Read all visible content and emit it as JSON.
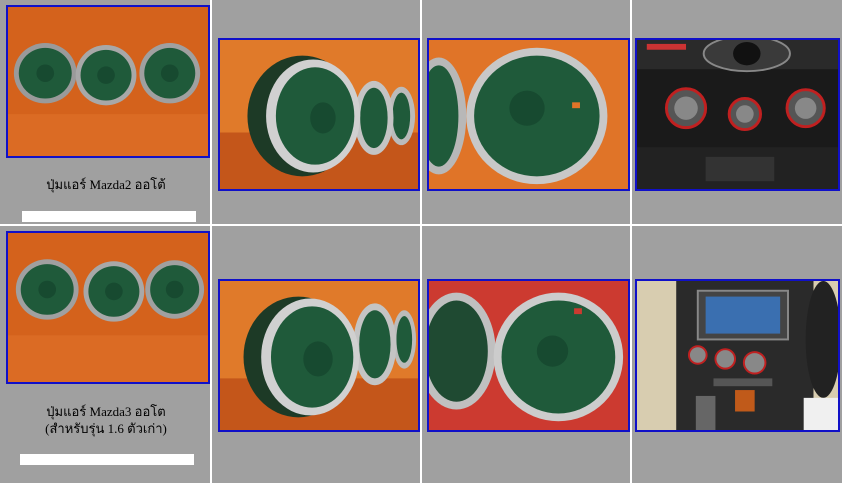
{
  "products": [
    {
      "title_line1": "ปุ่มแอร์ Mazda2 ออโต้",
      "title_line2": "",
      "thumbnails": [
        {
          "name": "three-knobs-photo"
        },
        {
          "name": "knob-side-angle-photo"
        },
        {
          "name": "knob-closeup-photo"
        },
        {
          "name": "dashboard-installed-photo"
        }
      ]
    },
    {
      "title_line1": "ปุ่มแอร์ Mazda3 ออโต",
      "title_line2": "(สำหรับรุ่น 1.6 ตัวเก่า)",
      "thumbnails": [
        {
          "name": "three-knobs-photo"
        },
        {
          "name": "knob-side-angle-photo"
        },
        {
          "name": "knob-closeup-photo"
        },
        {
          "name": "dashboard-installed-photo"
        }
      ]
    }
  ],
  "colors": {
    "page_background": "#a0a0a0",
    "cell_border": "#ffffff",
    "thumbnail_border": "#1010c8",
    "knob_green": "#1f5a3a",
    "leather_orange": "#d8621a",
    "chrome": "#d9d9d9"
  }
}
